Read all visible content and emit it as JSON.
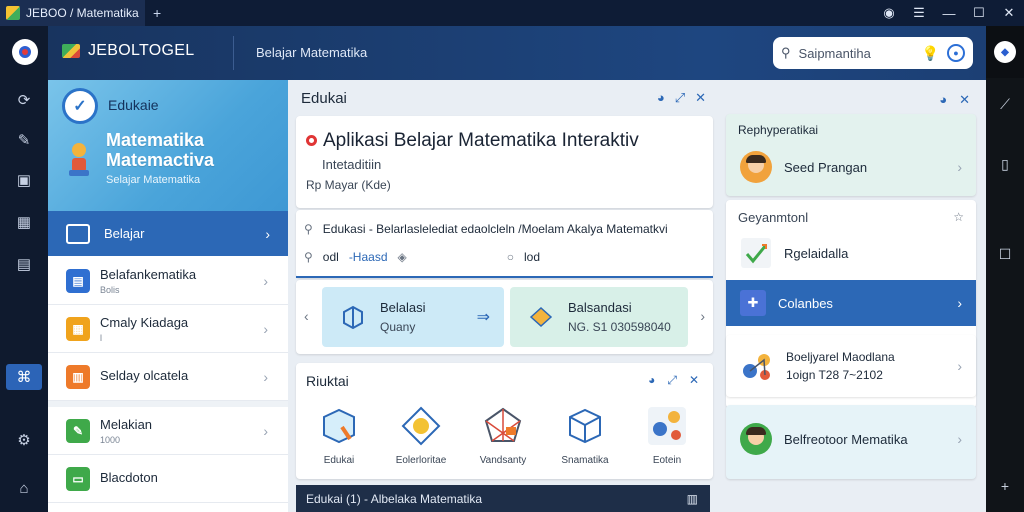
{
  "titlebar": {
    "tab_title": "JEBOO / Matematika",
    "add_tab": "+"
  },
  "header": {
    "brand": "JEBOLTOGEL",
    "title": "Belajar Matematika",
    "search_value": "Saipmantiha"
  },
  "sidebar": {
    "hero": {
      "badge_label": "Edukaie",
      "title_line1": "Matematika",
      "title_line2": "Matemactiva",
      "subtitle": "Selajar Matematika"
    },
    "active_item": {
      "label": "Belajar"
    },
    "items": [
      {
        "label": "Belafankematika",
        "sub": "Bolis",
        "color": "#2f6fd1",
        "icon": "book-icon"
      },
      {
        "label": "Cmaly Kiadaga",
        "sub": "l",
        "color": "#f0a31c",
        "icon": "calculator-icon"
      },
      {
        "label": "Selday olcatela",
        "sub": "",
        "color": "#ee7a2a",
        "icon": "chart-icon"
      },
      {
        "label": "Melakian",
        "sub": "1000",
        "color": "#3fa94a",
        "icon": "edit-icon"
      },
      {
        "label": "Blacdoton",
        "sub": "",
        "color": "#3fa94a",
        "icon": "document-icon"
      }
    ]
  },
  "main": {
    "heading": "Edukai",
    "card": {
      "title": "Aplikasi Belajar Matematika Interaktiv",
      "subtitle": "Intetaditiin",
      "meta": "Rp  Mayar (Kde)",
      "info_line1": "Edukasi - Belarlaslelediat edaolcleln /Moelam Akalya Matematkvi",
      "info_a": "odl",
      "info_b": "-Haasd",
      "info_c": "lod"
    },
    "options": [
      {
        "title": "Belalasi",
        "sub": "Quany",
        "bg": "#cdeaf7"
      },
      {
        "title": "Balsandasi",
        "sub": "NG. S1 030598040",
        "bg": "#d8f0e8"
      }
    ],
    "tools_heading": "Riuktai",
    "tools": [
      "Edukai",
      "Eolerloritae",
      "Vandsanty",
      "Snamatika",
      "Eotein"
    ],
    "footer": "Edukai  (1) - Albelaka Matematika"
  },
  "rpanel": {
    "top_card_heading": "Rephyperatikai",
    "top_card_row": "Seed Prangan",
    "list_heading": "Geyanmtonl",
    "list_item1": "Rgelaidalla",
    "list_item2": "Colanbes",
    "card2_title": "Boeljyarel Maodlana",
    "card2_sub": "1oign  T28 7~2102",
    "card3_title": "Belfreotoor Mematika"
  },
  "colors": {
    "accent": "#2c68b6",
    "header": "#1e4680",
    "sidebar_hero": "#4aa4da"
  }
}
